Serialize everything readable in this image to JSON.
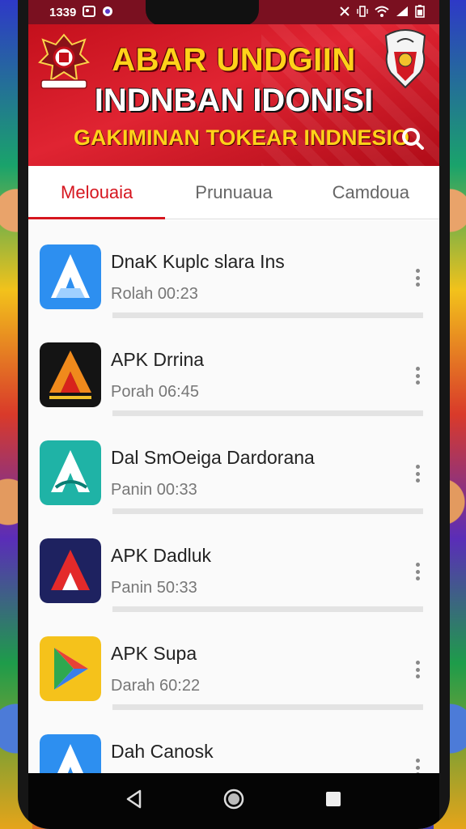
{
  "status_bar": {
    "time": "1339",
    "left_icons": [
      "gallery-icon",
      "chat-icon"
    ],
    "right_icons": [
      "alarm-icon",
      "vibrate-icon",
      "wifi-icon",
      "signal-icon",
      "battery-icon"
    ]
  },
  "header": {
    "line1": "ABAR UNDGIIN",
    "line2": "INDNBAN IDONISI",
    "line3": "GAKIMINAN TOKEAR INDNESIO",
    "colors": {
      "banner": "#d8141f",
      "accent_yellow": "#ffd21a"
    },
    "left_emblem": "garuda-emblem-icon",
    "right_emblem": "eagle-crest-icon",
    "search_icon": "search-icon"
  },
  "tabs": [
    {
      "label": "Melouaia",
      "active": true
    },
    {
      "label": "Prunuaua",
      "active": false
    },
    {
      "label": "Camdoua",
      "active": false
    }
  ],
  "apps": [
    {
      "name": "DnaK Kuplc slara  Ins",
      "time": "Rolah 00:23",
      "icon": "blue-a-icon"
    },
    {
      "name": "APK Drrina",
      "time": "Porah 06:45",
      "icon": "orange-a-dark-icon"
    },
    {
      "name": "Dal SmOeiga Dardorana",
      "time": "Panin 00:33",
      "icon": "teal-a-icon"
    },
    {
      "name": "APK Dadluk",
      "time": "Panin 50:33",
      "icon": "red-a-navy-icon"
    },
    {
      "name": "APK Supa",
      "time": "Darah 60:22",
      "icon": "play-store-icon"
    },
    {
      "name": "Dah Canosk",
      "time": "",
      "icon": "blue-a-icon"
    }
  ],
  "nav_bar": {
    "buttons": [
      "back-icon",
      "home-icon",
      "recents-icon"
    ]
  }
}
